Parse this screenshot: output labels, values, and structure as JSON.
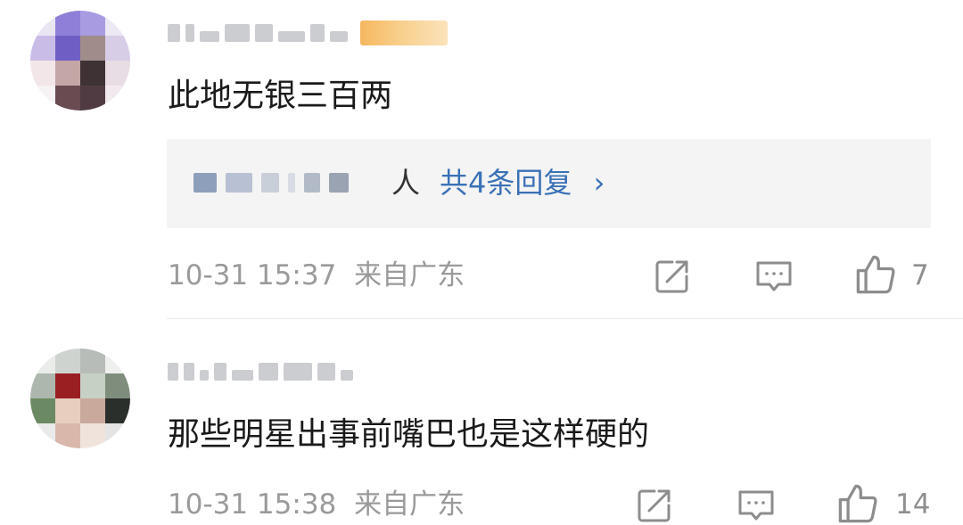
{
  "comments": [
    {
      "username": "",
      "text": "此地无银三百两",
      "reply_summary": {
        "names_tail": "人",
        "count_label": "共4条回复",
        "chevron": "›",
        "chevron_icon": "chevron-right-icon"
      },
      "timestamp": "10-31 15:37",
      "location": "来自广东",
      "likes": "7",
      "icons": [
        "share-icon",
        "comment-icon",
        "like-icon"
      ]
    },
    {
      "username": "",
      "text": "那些明星出事前嘴巴也是这样硬的",
      "timestamp": "10-31 15:38",
      "location": "来自广东",
      "likes": "14",
      "icons": [
        "share-icon",
        "comment-icon",
        "like-icon"
      ]
    }
  ],
  "colors": {
    "link_blue": "#3a71b6",
    "meta_gray": "#9a9a9a",
    "reply_bg": "#f4f4f4",
    "vip_badge": "#f5b760"
  }
}
